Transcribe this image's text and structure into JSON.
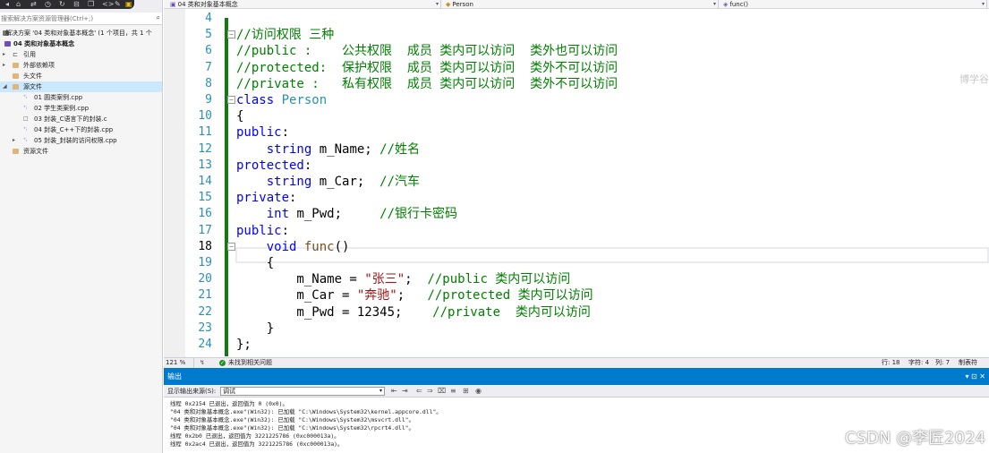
{
  "solution_explorer": {
    "search_placeholder": "搜索解决方案资源管理器(Ctrl+;)",
    "solution_label": "解决方案 '04 类和对象基本概念' (1 个项目，共 1 个",
    "project": "04 类和对象基本概念",
    "items": [
      {
        "label": "引用"
      },
      {
        "label": "外部依赖项"
      },
      {
        "label": "头文件"
      },
      {
        "label": "源文件"
      },
      {
        "label": "01 圆类案例.cpp"
      },
      {
        "label": "02 学生类案例.cpp"
      },
      {
        "label": "03 封装_C语言下的封装.c"
      },
      {
        "label": "04 封装_C++下的封装.cpp"
      },
      {
        "label": "05 封装_封装的访问权限.cpp"
      },
      {
        "label": "资源文件"
      }
    ]
  },
  "nav_bar": {
    "project": "04 类和对象基本概念",
    "class": "Person",
    "member": "func()"
  },
  "editor": {
    "lines": [
      {
        "n": "4",
        "t": [],
        "fold": ""
      },
      {
        "n": "5",
        "t": [
          [
            "c-cm",
            "//访问权限 三种"
          ]
        ],
        "fold": "⊟"
      },
      {
        "n": "6",
        "t": [
          [
            "c-cm",
            "//public :    公共权限  成员 类内可以访问  类外也可以访问"
          ]
        ],
        "fold": ""
      },
      {
        "n": "7",
        "t": [
          [
            "c-cm",
            "//protected:  保护权限  成员 类内可以访问  类外不可以访问"
          ]
        ],
        "fold": ""
      },
      {
        "n": "8",
        "t": [
          [
            "c-cm",
            "//private :   私有权限  成员 类内可以访问  类外不可以访问"
          ]
        ],
        "fold": ""
      },
      {
        "n": "9",
        "t": [
          [
            "c-kw",
            "class"
          ],
          [
            "c-tx",
            " "
          ],
          [
            "c-ty",
            "Person"
          ]
        ],
        "fold": "⊟"
      },
      {
        "n": "10",
        "t": [
          [
            "c-tx",
            "{"
          ]
        ],
        "fold": ""
      },
      {
        "n": "11",
        "t": [
          [
            "c-kw",
            "public"
          ],
          [
            "c-tx",
            ":"
          ]
        ],
        "fold": ""
      },
      {
        "n": "12",
        "t": [
          [
            "c-tx",
            "    "
          ],
          [
            "c-kw",
            "string"
          ],
          [
            "c-tx",
            " m_Name; "
          ],
          [
            "c-cm",
            "//姓名"
          ]
        ],
        "fold": ""
      },
      {
        "n": "13",
        "t": [
          [
            "c-kw",
            "protected"
          ],
          [
            "c-tx",
            ":"
          ]
        ],
        "fold": ""
      },
      {
        "n": "14",
        "t": [
          [
            "c-tx",
            "    "
          ],
          [
            "c-kw",
            "string"
          ],
          [
            "c-tx",
            " m_Car;  "
          ],
          [
            "c-cm",
            "//汽车"
          ]
        ],
        "fold": ""
      },
      {
        "n": "15",
        "t": [
          [
            "c-kw",
            "private"
          ],
          [
            "c-tx",
            ":"
          ]
        ],
        "fold": ""
      },
      {
        "n": "16",
        "t": [
          [
            "c-tx",
            "    "
          ],
          [
            "c-kw",
            "int"
          ],
          [
            "c-tx",
            " m_Pwd;     "
          ],
          [
            "c-cm",
            "//银行卡密码"
          ]
        ],
        "fold": ""
      },
      {
        "n": "17",
        "t": [
          [
            "c-kw",
            "public"
          ],
          [
            "c-tx",
            ":"
          ]
        ],
        "fold": ""
      },
      {
        "n": "18",
        "t": [
          [
            "c-tx",
            "    "
          ],
          [
            "c-kw",
            "void"
          ],
          [
            "c-tx",
            " "
          ],
          [
            "c-fn",
            "func"
          ],
          [
            "c-tx",
            "()"
          ]
        ],
        "fold": "⊟"
      },
      {
        "n": "19",
        "t": [
          [
            "c-tx",
            "    {"
          ]
        ],
        "fold": ""
      },
      {
        "n": "20",
        "t": [
          [
            "c-tx",
            "        m_Name = "
          ],
          [
            "c-st",
            "\"张三\""
          ],
          [
            "c-tx",
            ";  "
          ],
          [
            "c-cm",
            "//public 类内可以访问"
          ]
        ],
        "fold": ""
      },
      {
        "n": "21",
        "t": [
          [
            "c-tx",
            "        m_Car = "
          ],
          [
            "c-st",
            "\"奔驰\""
          ],
          [
            "c-tx",
            ";   "
          ],
          [
            "c-cm",
            "//protected 类内可以访问"
          ]
        ],
        "fold": ""
      },
      {
        "n": "22",
        "t": [
          [
            "c-tx",
            "        m_Pwd = 12345;    "
          ],
          [
            "c-cm",
            "//private  类内可以访问"
          ]
        ],
        "fold": ""
      },
      {
        "n": "23",
        "t": [
          [
            "c-tx",
            "    }"
          ]
        ],
        "fold": ""
      },
      {
        "n": "24",
        "t": [
          [
            "c-tx",
            "};"
          ]
        ],
        "fold": ""
      }
    ],
    "current_line": "18",
    "watermark": "博学谷"
  },
  "status": {
    "zoom": "121 %",
    "issues": "未找到相关问题",
    "line": "行: 18",
    "char": "字符: 4",
    "col": "列: 7",
    "tab": "制表符"
  },
  "output": {
    "title": "输出",
    "source_label": "显示输出来源(S):",
    "source_value": "调试",
    "lines": [
      "线程 0x2154 已退出，返回值为 0 (0x0)。",
      "\"04 类和对象基本概念.exe\"(Win32): 已加载 \"C:\\Windows\\System32\\kernel.appcore.dll\"。",
      "\"04 类和对象基本概念.exe\"(Win32): 已加载 \"C:\\Windows\\System32\\msvcrt.dll\"。",
      "\"04 类和对象基本概念.exe\"(Win32): 已加载 \"C:\\Windows\\System32\\rpcrt4.dll\"。",
      "线程 0x2b0 已退出，返回值为 3221225786 (0xc000013a)。",
      "线程 0x2ac4 已退出，返回值为 3221225786 (0xc000013a)。"
    ]
  },
  "watermark": "CSDN @李匠2024"
}
